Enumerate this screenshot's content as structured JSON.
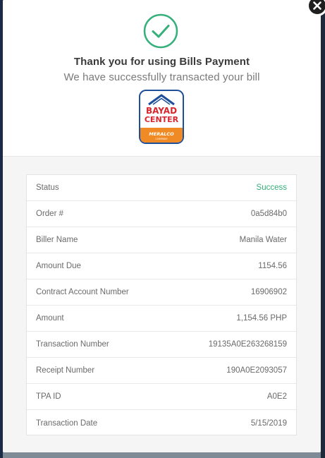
{
  "dialog": {
    "title": "Thank you for using Bills Payment",
    "subtitle": "We have successfully transacted your bill",
    "close_label": ""
  },
  "logo": {
    "line1": "BAYAD",
    "line2": "CENTER",
    "brand": "MERALCO",
    "brand_sub": "COMPANY"
  },
  "icons": {
    "success": "check-circle-icon",
    "close": "close-icon"
  },
  "colors": {
    "success_green": "#35b07a",
    "logo_blue": "#1d4f9b",
    "logo_red": "#d8262e",
    "logo_orange": "#f08a24"
  },
  "details": [
    {
      "label": "Status",
      "value": "Success"
    },
    {
      "label": "Order #",
      "value": "0a5d84b0"
    },
    {
      "label": "Biller Name",
      "value": "Manila Water"
    },
    {
      "label": "Amount Due",
      "value": "1154.56"
    },
    {
      "label": "Contract Account Number",
      "value": "16906902"
    },
    {
      "label": "Amount",
      "value": "1,154.56 PHP"
    },
    {
      "label": "Transaction Number",
      "value": "19135A0E263268159"
    },
    {
      "label": "Receipt Number",
      "value": "190A0E2093057"
    },
    {
      "label": "TPA ID",
      "value": "A0E2"
    },
    {
      "label": "Transaction Date",
      "value": "5/15/2019"
    }
  ]
}
